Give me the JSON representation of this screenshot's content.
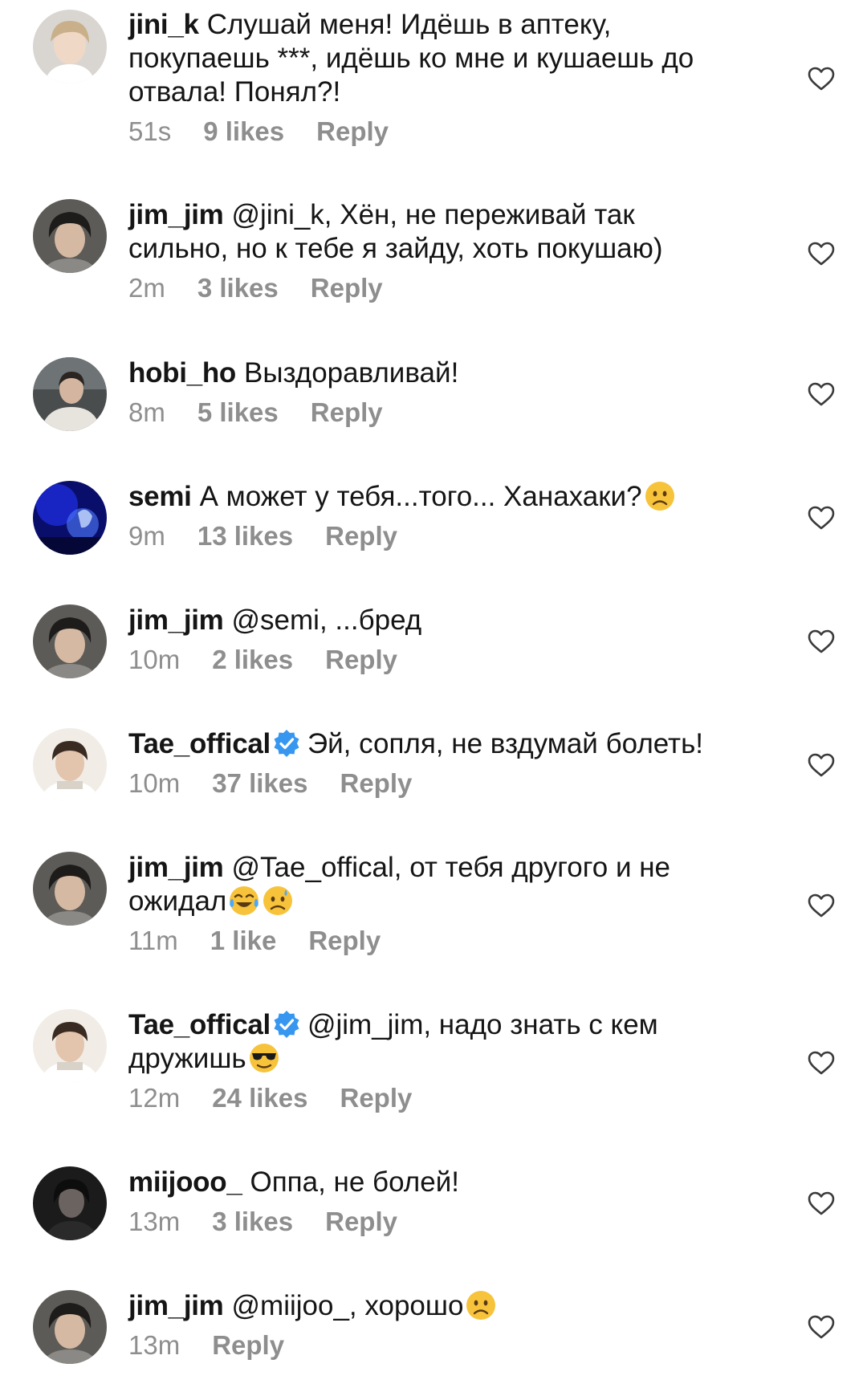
{
  "comments": [
    {
      "username": "jini_k",
      "verified": false,
      "text": "Слушай меня! Идёшь в аптеку, покупаешь ***, идёшь ко мне и кушаешь до отвала! Понял?!",
      "time": "51s",
      "likes": "9 likes",
      "reply": "Reply",
      "avatar_icon": "person-avatar-light"
    },
    {
      "username": "jim_jim",
      "verified": false,
      "text": "@jini_k, Хён, не переживай так сильно, но к тебе я зайду, хоть покушаю)",
      "time": "2m",
      "likes": "3 likes",
      "reply": "Reply",
      "avatar_icon": "person-avatar-dark"
    },
    {
      "username": "hobi_ho",
      "verified": false,
      "text": "Выздоравливай!",
      "time": "8m",
      "likes": "5 likes",
      "reply": "Reply",
      "avatar_icon": "person-avatar-street"
    },
    {
      "username": "semi",
      "verified": false,
      "text": "А может у тебя...того... Ханахаки?",
      "emoji": "worried-face",
      "time": "9m",
      "likes": "13 likes",
      "reply": "Reply",
      "avatar_icon": "blue-concert-avatar"
    },
    {
      "username": "jim_jim",
      "verified": false,
      "text": "@semi, ...бред",
      "time": "10m",
      "likes": "2 likes",
      "reply": "Reply",
      "avatar_icon": "person-avatar-dark"
    },
    {
      "username": "Tae_offical",
      "verified": true,
      "text": "Эй, сопля, не вздумай болеть!",
      "time": "10m",
      "likes": "37 likes",
      "reply": "Reply",
      "avatar_icon": "person-avatar-pale"
    },
    {
      "username": "jim_jim",
      "verified": false,
      "text": "@Tae_offical, от тебя другого и не ожидал",
      "emoji2": [
        "tears-of-joy-face",
        "sad-sweat-face"
      ],
      "time": "11m",
      "likes": "1 like",
      "reply": "Reply",
      "avatar_icon": "person-avatar-dark"
    },
    {
      "username": "Tae_offical",
      "verified": true,
      "text": "@jim_jim, надо знать с кем дружишь",
      "emoji": "sunglasses-face",
      "time": "12m",
      "likes": "24 likes",
      "reply": "Reply",
      "avatar_icon": "person-avatar-pale"
    },
    {
      "username": "miijooo_",
      "verified": false,
      "text": "Оппа, не болей!",
      "time": "13m",
      "likes": "3 likes",
      "reply": "Reply",
      "avatar_icon": "person-avatar-black"
    },
    {
      "username": "jim_jim",
      "verified": false,
      "text": "@miijoo_, хорошо",
      "emoji": "worried-face",
      "time": "13m",
      "reply": "Reply",
      "avatar_icon": "person-avatar-dark"
    }
  ],
  "colors": {
    "text": "#151515",
    "meta": "#8e8e8e",
    "verified": "#3797f0",
    "heart_stroke": "#3a3a3a"
  }
}
